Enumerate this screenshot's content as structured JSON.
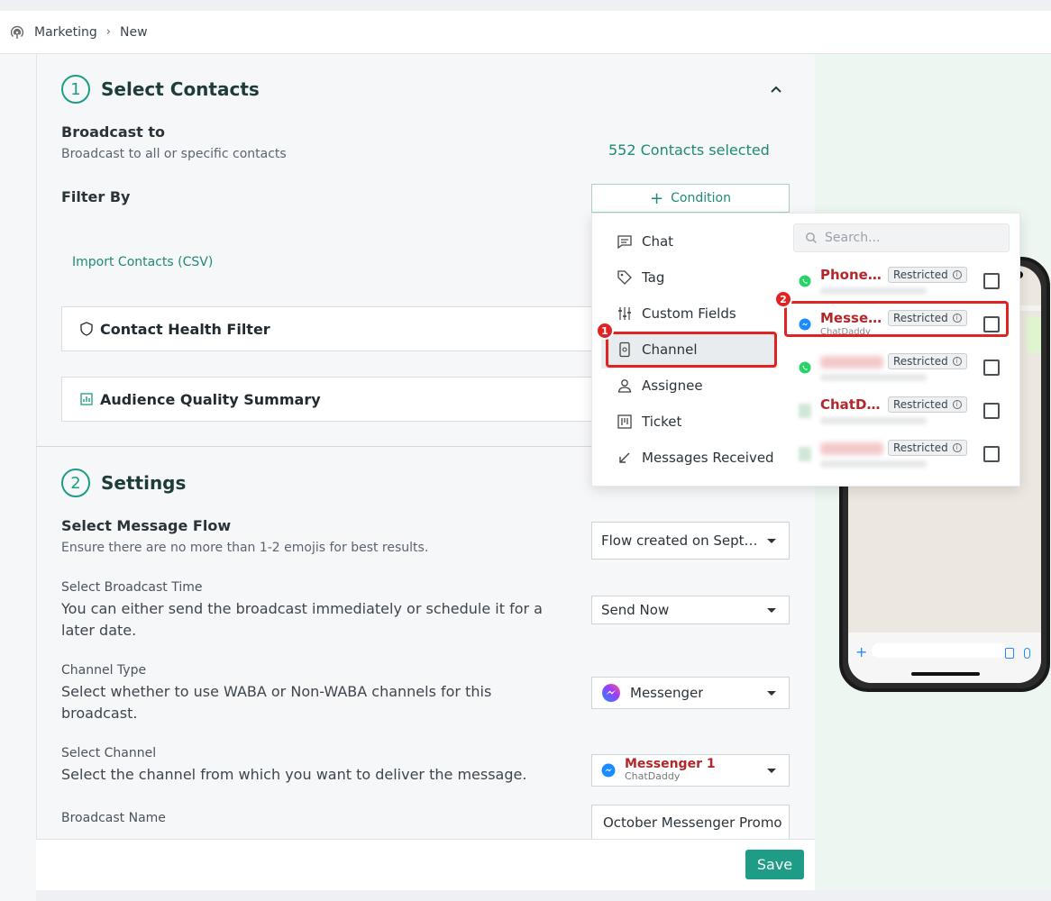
{
  "breadcrumb": {
    "root": "Marketing",
    "current": "New"
  },
  "section1": {
    "step": "1",
    "title": "Select Contacts",
    "broadcast_to_label": "Broadcast to",
    "broadcast_to_desc": "Broadcast to all or specific contacts",
    "contacts_selected": "552 Contacts selected",
    "filter_by_label": "Filter By",
    "condition_button": "Condition",
    "import_link": "Import Contacts (CSV)",
    "contact_health_filter": "Contact Health Filter",
    "audience_quality_summary": "Audience Quality Summary"
  },
  "condition_menu": {
    "items": [
      {
        "label": "Chat",
        "icon": "chat-icon"
      },
      {
        "label": "Tag",
        "icon": "tag-icon"
      },
      {
        "label": "Custom Fields",
        "icon": "sliders-icon"
      },
      {
        "label": "Channel",
        "icon": "device-icon"
      },
      {
        "label": "Assignee",
        "icon": "person-icon"
      },
      {
        "label": "Ticket",
        "icon": "ticket-icon"
      },
      {
        "label": "Messages Received",
        "icon": "arrow-down-left-icon"
      }
    ],
    "selected": "Channel",
    "search_placeholder": "Search...",
    "channels": [
      {
        "name": "Phone 1 ...",
        "type": "whatsapp",
        "status": "Restricted"
      },
      {
        "name": "Messen...",
        "sub": "ChatDaddy",
        "type": "messenger",
        "status": "Restricted"
      },
      {
        "name": "",
        "type": "whatsapp",
        "status": "Restricted"
      },
      {
        "name": "ChatDa...",
        "type": "other",
        "status": "Restricted"
      },
      {
        "name": "",
        "type": "other",
        "status": "Restricted"
      }
    ],
    "annotation_badges": [
      "1",
      "2"
    ]
  },
  "section2": {
    "step": "2",
    "title": "Settings",
    "message_flow_label": "Select Message Flow",
    "message_flow_desc": "Ensure there are no more than 1-2 emojis for best results.",
    "message_flow_value": "Flow created on Septe...",
    "broadcast_time_label": "Select Broadcast Time",
    "broadcast_time_desc": "You can either send the broadcast immediately or schedule it for a later date.",
    "broadcast_time_value": "Send Now",
    "channel_type_label": "Channel Type",
    "channel_type_desc": "Select whether to use WABA or Non-WABA channels for this broadcast.",
    "channel_type_value": "Messenger",
    "select_channel_label": "Select Channel",
    "select_channel_desc": "Select the channel from which you want to deliver the message.",
    "select_channel_value": "Messenger 1",
    "select_channel_sub": "ChatDaddy",
    "broadcast_name_label": "Broadcast Name",
    "broadcast_name_value": "October Messenger Promo"
  },
  "footer": {
    "save_button": "Save"
  },
  "colors": {
    "accent": "#1e9c86",
    "danger": "#e02424",
    "channel_name": "#b3262a",
    "whatsapp": "#25d366",
    "messenger": "#1a8cff"
  }
}
